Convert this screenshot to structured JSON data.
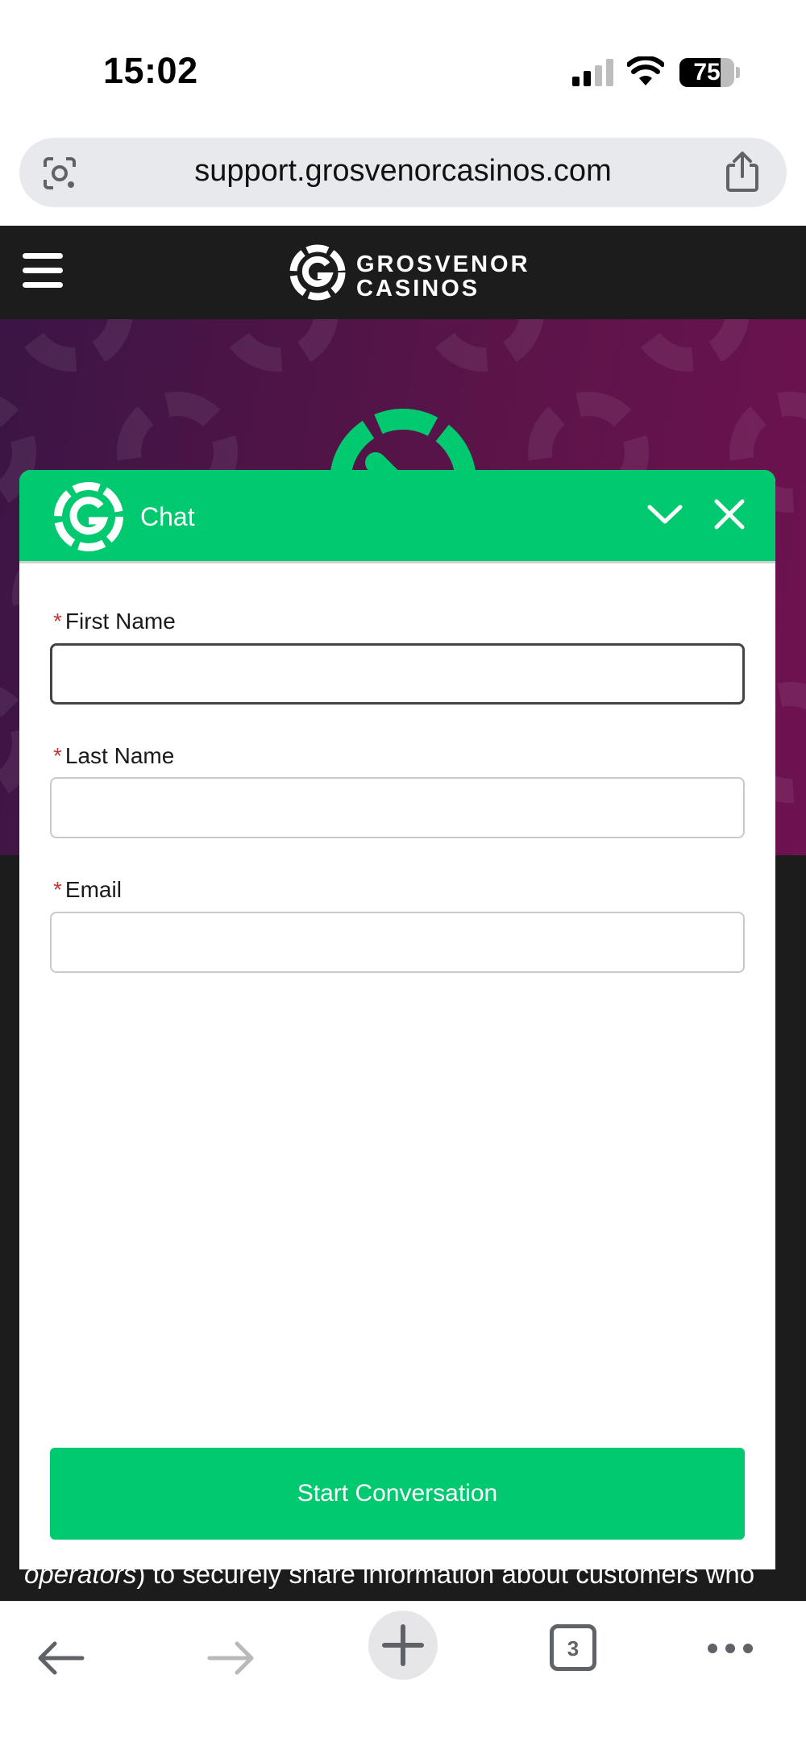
{
  "status_bar": {
    "time": "15:02",
    "battery": "75",
    "battery_level": 0.75
  },
  "browser": {
    "url": "support.grosvenorcasinos.com",
    "tab_count": "3"
  },
  "site": {
    "logo_line1": "GROSVENOR",
    "logo_line2": "CASINOS"
  },
  "chat": {
    "title": "Chat",
    "fields": [
      {
        "label": "First Name",
        "required_mark": "*",
        "value": ""
      },
      {
        "label": "Last Name",
        "required_mark": "*",
        "value": ""
      },
      {
        "label": "Email",
        "required_mark": "*",
        "value": ""
      }
    ],
    "start_button": "Start Conversation"
  },
  "page_text": {
    "italic": "operators",
    "rest": ") to securely share information about customers who"
  },
  "colors": {
    "accent_green": "#00c96f",
    "header_dark": "#1c1c1c",
    "hero_purple": "#5a1448",
    "required_red": "#c23934"
  },
  "icons": {
    "lens": "google-lens-icon",
    "share": "share-icon",
    "menu": "hamburger-icon",
    "minimize": "chevron-down-icon",
    "close": "close-icon",
    "back": "arrow-left-icon",
    "forward": "arrow-right-icon",
    "new_tab": "plus-icon",
    "more": "ellipsis-icon"
  }
}
